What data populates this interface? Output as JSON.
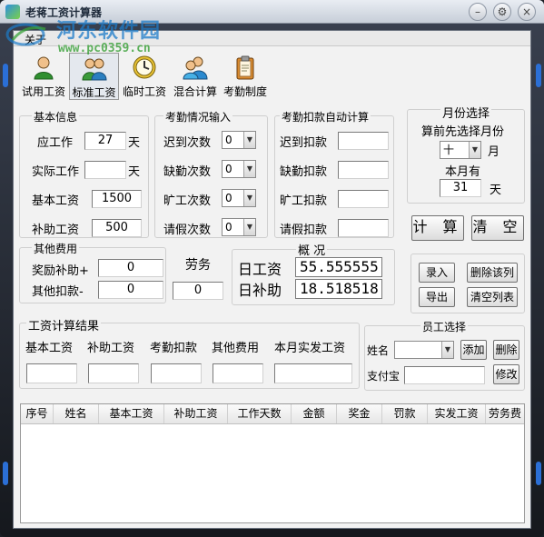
{
  "window": {
    "title": "老蒋工资计算器",
    "menu_about": "关于",
    "watermark_text": "河东软件园",
    "watermark_url": "www.pc0359.cn"
  },
  "toolbar": {
    "tools": [
      {
        "label": "试用工资",
        "icon": "person-icon"
      },
      {
        "label": "标准工资",
        "icon": "group-icon",
        "active": true
      },
      {
        "label": "临时工资",
        "icon": "clock-icon"
      },
      {
        "label": "混合计算",
        "icon": "users-icon"
      },
      {
        "label": "考勤制度",
        "icon": "clipboard-icon"
      }
    ]
  },
  "basic": {
    "title": "基本信息",
    "should_work_label": "应工作",
    "should_work_value": "27",
    "should_work_unit": "天",
    "actual_work_label": "实际工作",
    "actual_work_value": "",
    "actual_work_unit": "天",
    "base_salary_label": "基本工资",
    "base_salary_value": "1500",
    "subsidy_label": "补助工资",
    "subsidy_value": "500"
  },
  "attendance": {
    "title": "考勤情况输入",
    "late_label": "迟到次数",
    "late_value": "0",
    "absent_label": "缺勤次数",
    "absent_value": "0",
    "truant_label": "旷工次数",
    "truant_value": "0",
    "leave_label": "请假次数",
    "leave_value": "0"
  },
  "deduction": {
    "title": "考勤扣款自动计算",
    "late_label": "迟到扣款",
    "absent_label": "缺勤扣款",
    "truant_label": "旷工扣款",
    "leave_label": "请假扣款"
  },
  "month": {
    "title": "月份选择",
    "prompt": "算前先选择月份",
    "month_value": "十",
    "month_unit": "月",
    "days_label": "本月有",
    "days_value": "31",
    "days_unit": "天"
  },
  "actions": {
    "calc": "计 算",
    "clear": "清 空"
  },
  "other_fees": {
    "title": "其他费用",
    "bonus_label": "奖励补助+",
    "bonus_value": "0",
    "deduct_label": "其他扣款-",
    "deduct_value": "0"
  },
  "labor": {
    "label": "劳务",
    "value": "0"
  },
  "overview": {
    "title": "概 况",
    "daily_wage_label": "日工资",
    "daily_wage_value": "55.555555",
    "daily_subsidy_label": "日补助",
    "daily_subsidy_value": "18.518518"
  },
  "list_buttons": {
    "enter": "录入",
    "delete_row": "删除该列",
    "export": "导出",
    "clear_list": "清空列表"
  },
  "result": {
    "title": "工资计算结果",
    "labels": [
      "基本工资",
      "补助工资",
      "考勤扣款",
      "其他费用",
      "本月实发工资"
    ],
    "values": [
      "",
      "",
      "",
      "",
      ""
    ]
  },
  "employee": {
    "title": "员工选择",
    "name_label": "姓名",
    "name_value": "",
    "add": "添加",
    "delete": "删除",
    "alipay_label": "支付宝",
    "alipay_value": "",
    "modify": "修改"
  },
  "grid": {
    "columns": [
      "序号",
      "姓名",
      "基本工资",
      "补助工资",
      "工作天数",
      "金额",
      "奖金",
      "罚款",
      "实发工资",
      "劳务费"
    ]
  }
}
